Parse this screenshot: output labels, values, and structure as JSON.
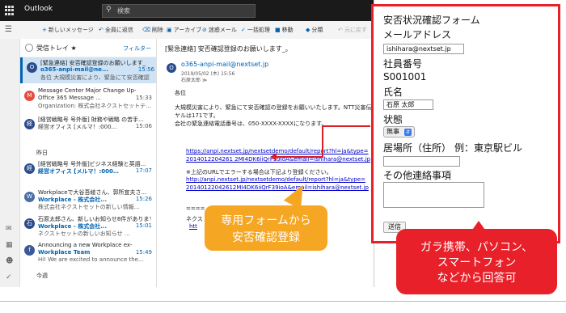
{
  "app": {
    "title": "Outlook"
  },
  "search": {
    "placeholder": "検索"
  },
  "toolbar": {
    "new_message": "新しいメッセージ",
    "reply_all": "全員に返信",
    "delete": "削除",
    "archive": "アーカイブ",
    "junk": "迷惑メール",
    "sweep": "一括処理",
    "move": "移動",
    "categorize": "分類",
    "undo": "元に戻す"
  },
  "folder": {
    "title": "受信トレイ ★",
    "filter": "フィルター"
  },
  "groups": {
    "yesterday": "昨日",
    "this_week": "今週"
  },
  "messages": [
    {
      "line1": "[緊急連絡] 安否確認登録のお願いします_",
      "sender": "o365-anpi-mail@ne...",
      "time": "15:56",
      "preview": "各位 大規模災害により、緊急にて安否確認",
      "avatar": "O"
    },
    {
      "line1": "Message Center Major Change Up-",
      "sender": "Office 365 Message ...",
      "time": "15:33",
      "preview": "Organization: 株式会社ネクストセットテ...",
      "avatar": "M"
    },
    {
      "line1": "[経営戦略号 号外版] 財務や戦略 の苦手...",
      "sender": "経営オフィス [メルマ！:000…",
      "time": "15:06",
      "preview": "",
      "avatar": "経"
    },
    {
      "line1": "[経営戦略号 号外版]ビジネス経験と英語...",
      "sender": "経営オフィス [メルマ！:000…",
      "time": "17:07",
      "preview": "",
      "avatar": "経"
    },
    {
      "line1": "Workplaceで大谷吾綾さん、郭所宣夫さ...",
      "sender": "Workplace - 株式会社...",
      "time": "15:26",
      "preview": "株式会社ネクストセットの新しい情報...",
      "avatar": "W"
    },
    {
      "line1": "石原太郎さん、新しいお知らせ8件があります",
      "sender": "Workplace - 株式会社...",
      "time": "15:01",
      "preview": "ネクストセットの新しいお知らせ ...",
      "avatar": "石"
    },
    {
      "line1": "Announcing a new Workplace ex-",
      "sender": "Workplace Team",
      "time": "15:49",
      "preview": "Hi! We are excited to announce the...",
      "avatar": "f"
    }
  ],
  "reading": {
    "subject": "[緊急連絡] 安否確認登録のお願いします_。",
    "sender": "o365-anpi-mail@nextset.jp",
    "date": "2019/05/02 (木) 15:56",
    "to": "石原太郎 ≫",
    "greeting": "各位",
    "body1": "大規模災害により、緊急にて安否確認の登録をお願いいたします。NTT災害伝言ダイ",
    "body2": "ヤルは171です。",
    "body3": "会社の緊急連絡電話番号は、050-XXXX-XXXXになります。",
    "link1a": "https://anpi.nextset.jp/nextsetdemo/default/report?hl=ja&type=",
    "link1b": "2014012204261 2MI4DK6iiQrF39ioA&email=ishihara@nextset.jp",
    "note": "※上記のURLでエラーする場合は下記より登録ください。",
    "link2a": "http://anpi.nextset.jp/nextsetdemo/default/report?hl=ja&type=",
    "link2b": "20140122042612MI4DK6iiQrF39ioA&email=ishihara@nextset.jp",
    "sep": "====",
    "footer1": "ネクス",
    "footer2": "htt"
  },
  "form": {
    "title": "安否状況確認フォーム",
    "email_label": "メールアドレス",
    "email_value": "ishihara@nextset.jp",
    "id_label": "社員番号",
    "id_value": "S001001",
    "name_label": "氏名",
    "name_value": "石原 太郎",
    "status_label": "状態",
    "status_value": "無事",
    "location_label": "居場所（住所）",
    "location_example": "例：東京駅ビル",
    "other_label": "その他連絡事項",
    "submit": "送信"
  },
  "callouts": {
    "yellow_line1": "専用フォームから",
    "yellow_line2": "安否確認登録",
    "red_line1": "ガラ携帯、パソコン、",
    "red_line2": "スマートフォン",
    "red_line3": "などから回答可"
  },
  "colors": {
    "accent": "#0063b1",
    "callout_red": "#e8202a",
    "callout_yellow": "#f5a623"
  }
}
